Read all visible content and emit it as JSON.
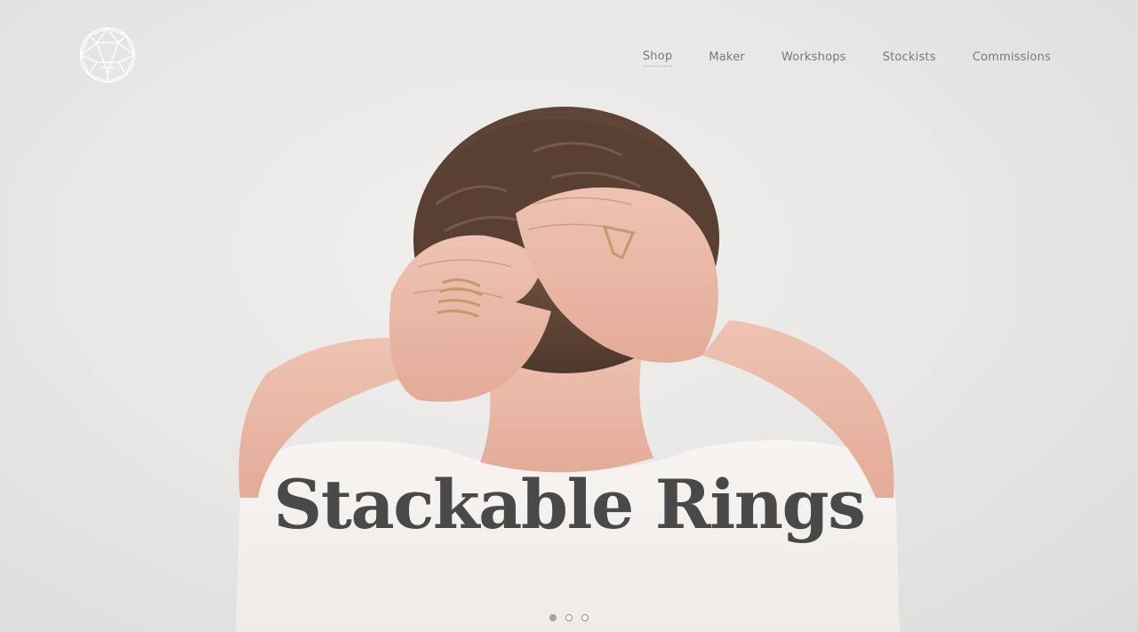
{
  "site": {
    "logo_icon": "geometric-A-monogram-icon"
  },
  "nav": {
    "items": [
      {
        "label": "Shop",
        "active": true
      },
      {
        "label": "Maker",
        "active": false
      },
      {
        "label": "Workshops",
        "active": false
      },
      {
        "label": "Stockists",
        "active": false
      },
      {
        "label": "Commissions",
        "active": false
      }
    ]
  },
  "hero": {
    "title": "Stackable Rings",
    "slide_count": 3,
    "active_slide": 1
  },
  "colors": {
    "background": "#e9e8e7",
    "title": "#4a4949",
    "nav_text": "#7a7876",
    "skin": "#e7b9a6",
    "hair": "#6b4e3f",
    "shirt": "#f6f3f0",
    "gold": "#c49a6c"
  }
}
